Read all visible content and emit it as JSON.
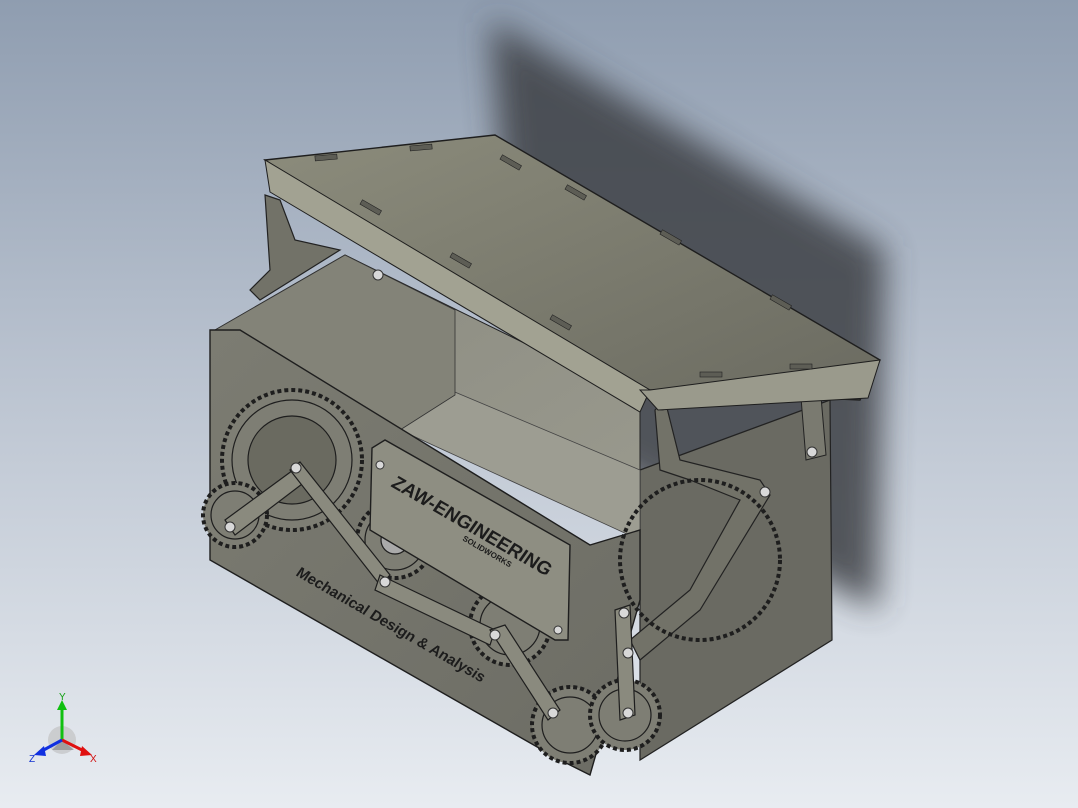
{
  "viewport": {
    "background_top": "#8f9db0",
    "background_bottom": "#e8ecf1",
    "model_color": "#6e6e64",
    "lid_color": "#868676",
    "shadow_color": "#3c3f44"
  },
  "nameplate": {
    "title": "ZAW-ENGINEERING",
    "subtitle": "SOLIDWORKS"
  },
  "engraving": {
    "text": "Mechanical Design & Analysis"
  },
  "triad": {
    "x_label": "X",
    "y_label": "Y",
    "z_label": "Z",
    "x_color": "#e01010",
    "y_color": "#10c010",
    "z_color": "#1030e0"
  }
}
